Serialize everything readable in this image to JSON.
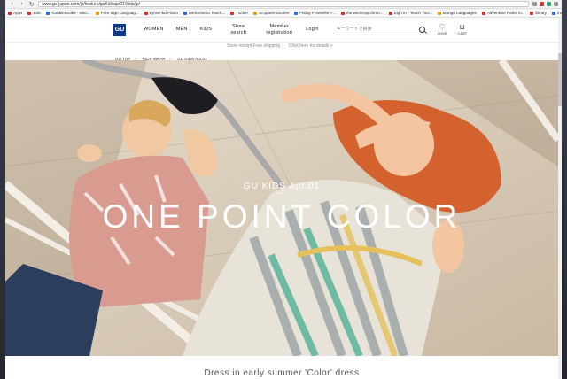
{
  "browser": {
    "url": "www.gu-japan.com/jp/feature/guKidsapr01/kids/jp/",
    "bookmarks": [
      "Apps",
      "Bob",
      "TumbleBooks - eBo...",
      "Free Sign Languag...",
      "bynoe-bd Piano",
      "Welcome to Teach...",
      "Tucker",
      "Scripture Stories",
      "Friday Freewrite +...",
      "the winthrop chron...",
      "Sign in - Teach You...",
      "Mango Languages",
      "Adventure Parks in...",
      "library",
      "the childrens hour"
    ]
  },
  "header": {
    "logo": "GU",
    "nav": [
      "WOMEN",
      "MEN",
      "KIDS",
      "Store search",
      "Member registration",
      "Login"
    ],
    "search_placeholder": "キーワードで検索",
    "icons": [
      {
        "name": "heart-icon",
        "label": "LOVE",
        "glyph": "♡"
      },
      {
        "name": "cart-icon",
        "label": "CART",
        "glyph": "🛒"
      }
    ],
    "notice": [
      "Store receipt Free shipping",
      "Click here for details >"
    ]
  },
  "breadcrumb": [
    "GU TOP",
    "KIDS WEAR",
    "GU KIDS Apr.01"
  ],
  "hero": {
    "kicker": "GU KIDS Apr.01",
    "wave": "〰",
    "headline": "ONE POINT COLOR"
  },
  "below_text": "Dress in early summer 'Color' dress",
  "colors": {
    "brand": "#0b3a8f"
  }
}
